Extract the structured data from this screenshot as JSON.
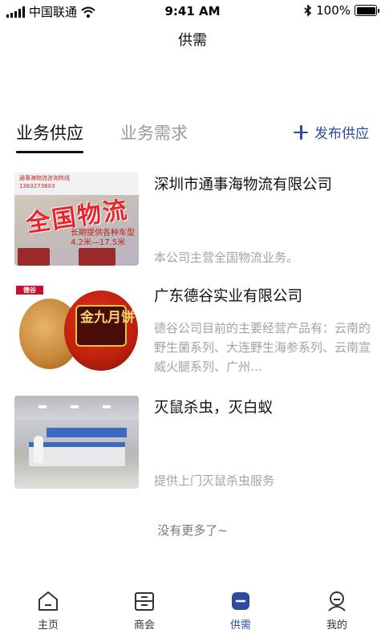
{
  "status_bar": {
    "carrier": "中国联通",
    "time": "9:41 AM",
    "battery": "100%"
  },
  "nav": {
    "title": "供需"
  },
  "tabs": {
    "active": "业务供应",
    "inactive": "业务需求",
    "publish_label": "发布供应"
  },
  "items": [
    {
      "title": "深圳市通事海物流有限公司",
      "desc": "本公司主营全国物流业务。",
      "thumb": {
        "banner": "通事海物流咨询热线",
        "phone": "1363273603",
        "headline": "全国物流",
        "sub1": "长期提供各种车型",
        "sub2": "4.2米—17.5米"
      }
    },
    {
      "title": "广东德谷实业有限公司",
      "desc": "德谷公司目前的主要经营产品有：云南的野生菌系列、大连野生海参系列、云南宣威火腿系列、广州…",
      "thumb": {
        "logo": "德谷",
        "tin_text": "金九月饼"
      }
    },
    {
      "title": "灭鼠杀虫，灭白蚁",
      "desc": "提供上门灭鼠杀虫服务",
      "thumb": {}
    }
  ],
  "footer_note": "没有更多了~",
  "tabbar": [
    {
      "label": "主页",
      "icon": "home-icon"
    },
    {
      "label": "商会",
      "icon": "chamber-icon"
    },
    {
      "label": "供需",
      "icon": "supply-icon",
      "active": true
    },
    {
      "label": "我的",
      "icon": "profile-icon"
    }
  ],
  "colors": {
    "accent": "#2c4b9e",
    "muted": "#a3a3a3"
  }
}
